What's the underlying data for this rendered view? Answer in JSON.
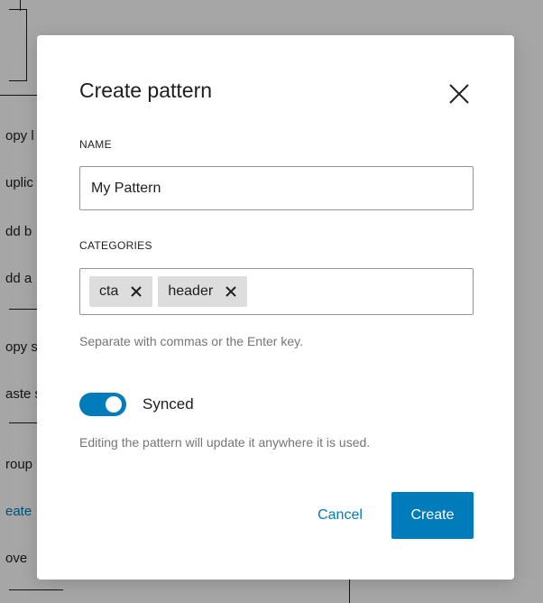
{
  "background_menu": {
    "items": [
      {
        "label": "opy l",
        "link": false
      },
      {
        "label": "uplic",
        "link": false
      },
      {
        "label": "dd b",
        "link": false
      },
      {
        "label": "dd a",
        "link": false
      },
      {
        "label": "opy s",
        "link": false
      },
      {
        "label": "aste s",
        "link": false
      },
      {
        "label": "roup",
        "link": false
      },
      {
        "label": "eate",
        "link": true
      },
      {
        "label": "ove",
        "link": false
      }
    ]
  },
  "modal": {
    "title": "Create pattern",
    "close_icon": "close-icon",
    "name": {
      "label": "NAME",
      "value": "My Pattern"
    },
    "categories": {
      "label": "CATEGORIES",
      "tokens": [
        "cta",
        "header"
      ],
      "remove_icon": "close-icon",
      "help": "Separate with commas or the Enter key."
    },
    "sync": {
      "label": "Synced",
      "enabled": true,
      "help": "Editing the pattern will update it anywhere it is used."
    },
    "cancel_label": "Cancel",
    "create_label": "Create"
  },
  "colors": {
    "accent": "#007cba",
    "text": "#1e1e1e",
    "muted": "#757575",
    "token_bg": "#dddddd"
  }
}
